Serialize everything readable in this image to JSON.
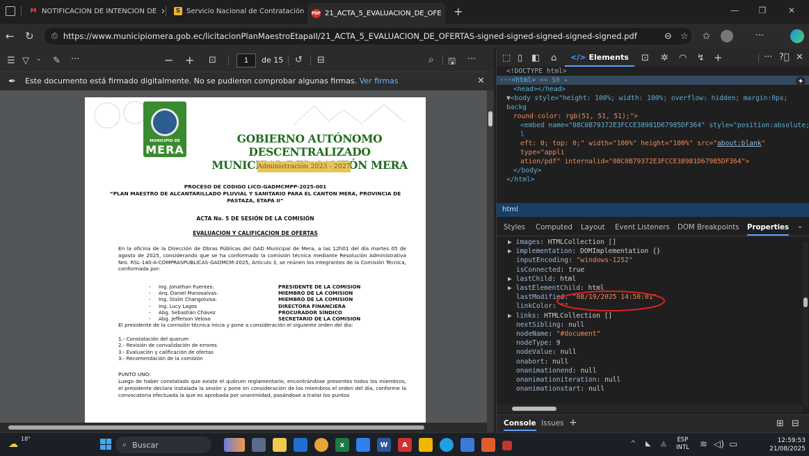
{
  "tabs": [
    {
      "title": "NOTIFICACION DE INTENCION DE",
      "icon": "gmail-icon",
      "icon_text": "M",
      "color": "#ea4335"
    },
    {
      "title": "Servicio Nacional de Contratación",
      "icon": "sercop-icon",
      "icon_text": "S",
      "color": "#f0b429"
    },
    {
      "title": "21_ACTA_5_EVALUACION_DE_OFE",
      "icon": "pdf-icon",
      "icon_text": "PDF",
      "color": "#d93025"
    }
  ],
  "address": {
    "url": "https://www.municipiomera.gob.ec/licitacionPlanMaestroEtapaII/21_ACTA_5_EVALUACION_DE_OFERTAS-signed-signed-signed-signed-signed.pdf"
  },
  "pdf_toolbar": {
    "minus": "−",
    "plus": "+",
    "page": "1",
    "of_pages": "de 15",
    "more": "···"
  },
  "signature_bar": {
    "message": "Este documento está firmado digitalmente. No se pudieron comprobar algunas firmas.",
    "link": "Ver firmas"
  },
  "document": {
    "header_line1": "GOBIERNO AUTÓNOMO DESCENTRALIZADO",
    "header_line2": "MUNICIPAL DEL CANTÓN MERA",
    "administration": "Administración 2023 - 2027",
    "logo_small": "MUNICIPIO DE",
    "logo_big": "MERA",
    "process_title": "PROCESO DE CODIGO LICO-GADMCMPP-2025-001",
    "project_title": "“PLAN MAESTRO DE ALCANTARILLADO PLUVIAL Y SANITARIO PARA EL CANTON MERA, PROVINCIA DE PASTAZA, ETAPA II”",
    "acta_title": "ACTA No. 5 DE SESIÓN DE LA COMISIÓN",
    "eval_title": "EVALUACION Y CALIFICACION DE OFERTAS",
    "intro": "En la oficina de la Dirección de Obras Públicas del GAD Municipal de Mera, a las 12h01 del día martes 05 de agosto de 2025, considerando que se ha conformado la comisión técnica mediante Resolución Administrativa Nro. RSL-140-A-COMPRASPUBLICAS-GADMCM-2025, Articulo 3, se reúnen los integrantes de la Comisión Técnica, conformada por:",
    "members": [
      {
        "name": "Ing. Jonathan Fuentes:",
        "role": "PRESIDENTE DE LA COMISION"
      },
      {
        "name": "Arq. Daniel Manosalvas:",
        "role": "MIEMBRO DE LA COMISION"
      },
      {
        "name": "Ing. Stalin Changoluisa:",
        "role": "MIEMBRO DE LA COMISION"
      },
      {
        "name": "Ing. Lucy Lagos",
        "role": "DIRECTORA FINANCIERA"
      },
      {
        "name": "Abg. Sebastián Chávez",
        "role": "PROCURADOR SÍNDICO"
      },
      {
        "name": "Abg. Jefferson Veloso",
        "role": "SECRETARIO DE LA COMISION"
      }
    ],
    "agenda_intro": "El presidente de la comisión técnica inicia y pone a consideración el siguiente orden del día:",
    "agenda": [
      "1.- Constatación del quorum",
      "2.- Revisión de convalidación de errores",
      "3.- Evaluación y calificación de ofertas",
      "3.- Recomendación de la comisión"
    ],
    "point_one": "PUNTO UNO:",
    "point_one_text": "Luego de haber constatado que existe el quórum reglamentario, encontrándose presentes todos los miembros, el presidente declara instalada la sesión y pone en consideración de los miembros el orden del día, conforme la convocatoria efectuada la que es aprobada por unanimidad, pasándose a tratar los puntos"
  },
  "devtools": {
    "elements_tab": "Elements",
    "breadcrumb": "html",
    "subtabs": [
      "Styles",
      "Computed",
      "Layout",
      "Event Listeners",
      "DOM Breakpoints",
      "Properties"
    ],
    "dom": {
      "doctype": "<!DOCTYPE html>",
      "html_line": "<html>",
      "html_suffix": "== $0",
      "head": "<head></head>",
      "body_open_1": "<body style=\"height: 100%; width: 100%; overflow: hidden; margin:0px; backg",
      "body_open_2": "round-color: rgb(51, 51, 51);\">",
      "embed_1": "<embed name=\"08C0B79372E3FCCE38981D67985DF364\" style=\"position:absolute; l",
      "embed_2": "eft: 0; top: 0;\" width=\"100%\" height=\"100%\" src=\"",
      "embed_src": "about:blank",
      "embed_2b": "\" type=\"appli",
      "embed_3": "ation/pdf\" internalid=\"08C0B79372E3FCCE38981D67985DF364\">",
      "body_close": "</body>",
      "html_close": "</html>"
    },
    "properties": [
      {
        "key": "images",
        "value": "HTMLCollection []",
        "expand": true
      },
      {
        "key": "implementation",
        "value": "DOMImplementation {}",
        "expand": true
      },
      {
        "key": "inputEncoding",
        "value": "\"windows-1252\"",
        "expand": false,
        "str": true
      },
      {
        "key": "isConnected",
        "value": "true",
        "expand": false
      },
      {
        "key": "lastChild",
        "value": "html",
        "expand": true
      },
      {
        "key": "lastElementChild",
        "value": "html",
        "expand": true
      },
      {
        "key": "lastModified",
        "value": "\"08/19/2025 14:50:01\"",
        "expand": false,
        "str": true
      },
      {
        "key": "linkColor",
        "value": "\"\"",
        "expand": false,
        "str": true
      },
      {
        "key": "links",
        "value": "HTMLCollection []",
        "expand": true
      },
      {
        "key": "nextSibling",
        "value": "null",
        "expand": false
      },
      {
        "key": "nodeName",
        "value": "\"#document\"",
        "expand": false,
        "str": true
      },
      {
        "key": "nodeType",
        "value": "9",
        "expand": false,
        "num": true
      },
      {
        "key": "nodeValue",
        "value": "null",
        "expand": false
      },
      {
        "key": "onabort",
        "value": "null",
        "expand": false
      },
      {
        "key": "onanimationend",
        "value": "null",
        "expand": false
      },
      {
        "key": "onanimationiteration",
        "value": "null",
        "expand": false
      },
      {
        "key": "onanimationstart",
        "value": "null",
        "expand": false
      }
    ],
    "console_tab": "Console",
    "issues_tab": "Issues"
  },
  "taskbar": {
    "weather": "18°",
    "search_placeholder": "Buscar",
    "lang": "ESP",
    "lang2": "INTL",
    "time": "12:59:53",
    "date": "21/08/2025"
  },
  "colors": {
    "annotation": "#e02020",
    "accent": "#1a73e8",
    "logo_green": "#3a8a2f",
    "title_green": "#1f6b1f"
  }
}
